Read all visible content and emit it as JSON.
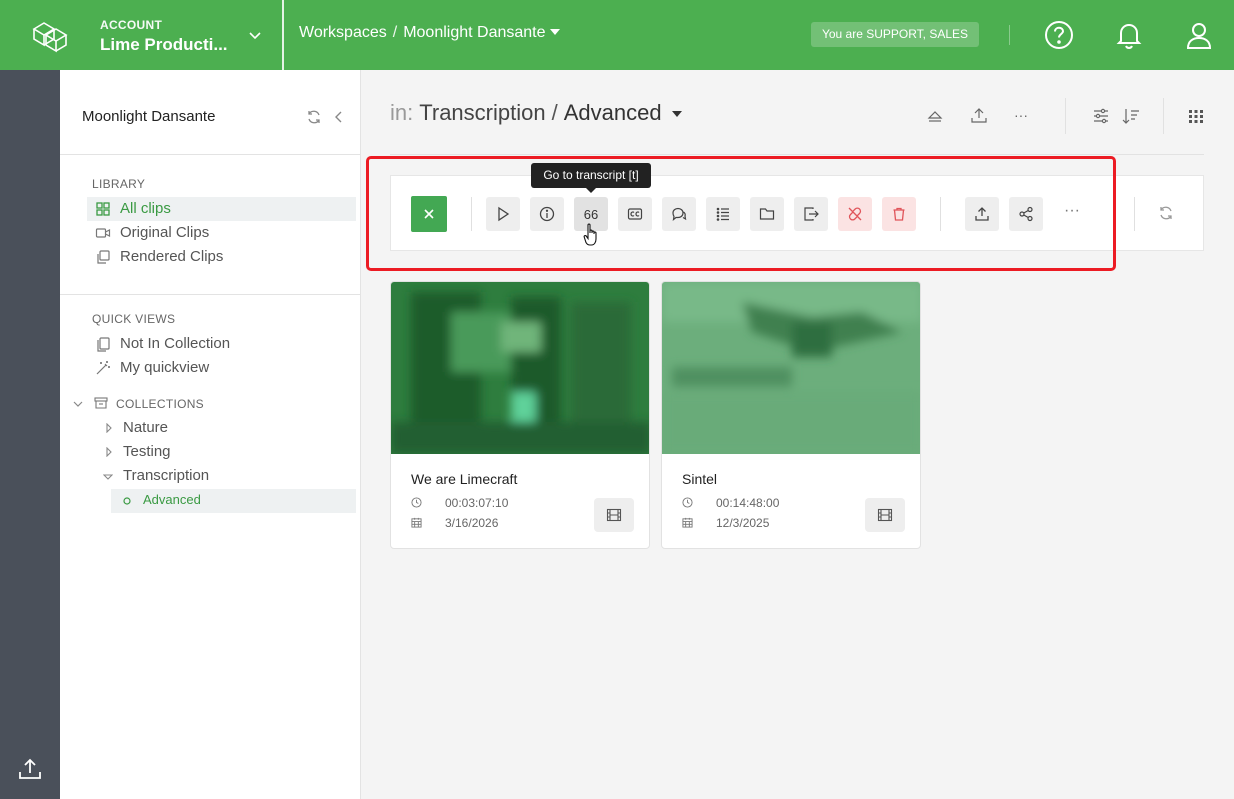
{
  "topbar": {
    "account_label": "ACCOUNT",
    "account_name": "Lime Producti...",
    "breadcrumb_workspaces": "Workspaces",
    "breadcrumb_sep": "/",
    "breadcrumb_project": "Moonlight Dansante",
    "role_badge": "You are SUPPORT, SALES"
  },
  "sidebar": {
    "title": "Moonlight Dansante",
    "library_header": "LIBRARY",
    "library_items": [
      {
        "label": "All clips"
      },
      {
        "label": "Original Clips"
      },
      {
        "label": "Rendered Clips"
      }
    ],
    "quickviews_header": "QUICK VIEWS",
    "quickviews": [
      {
        "label": "Not In Collection"
      },
      {
        "label": "My quickview"
      }
    ],
    "collections_header": "COLLECTIONS",
    "collections": [
      {
        "label": "Nature"
      },
      {
        "label": "Testing"
      },
      {
        "label": "Transcription"
      }
    ],
    "sub_collection": "Advanced"
  },
  "main": {
    "in_label": "in:",
    "path_parent": "Transcription",
    "path_sep": "/",
    "path_current": "Advanced"
  },
  "toolbar": {
    "transcript_label": "66",
    "tooltip": "Go to transcript [t]",
    "more_label": "···"
  },
  "clips": [
    {
      "title": "We are Limecraft",
      "duration": "00:03:07:10",
      "date": "3/16/2026"
    },
    {
      "title": "Sintel",
      "duration": "00:14:48:00",
      "date": "12/3/2025"
    }
  ],
  "colors": {
    "brand": "#4caf50",
    "rail": "#4a505a",
    "highlight": "#ec1b23",
    "danger_bg": "#fbe3e3"
  }
}
